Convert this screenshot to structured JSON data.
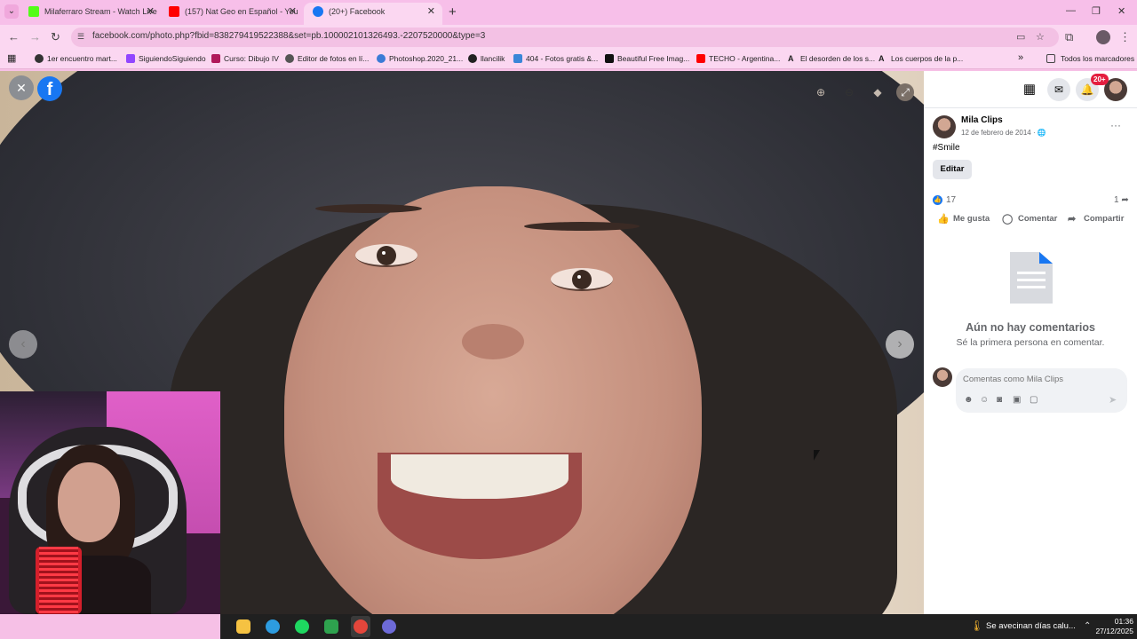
{
  "browser": {
    "tabs": [
      {
        "title": "Milaferraro Stream - Watch Live",
        "favicon_color": "#53fc18"
      },
      {
        "title": "(157) Nat Geo en Español - You",
        "favicon_color": "#ff0000"
      },
      {
        "title": "(20+) Facebook",
        "favicon_color": "#1877f2"
      }
    ],
    "new_tab": "+",
    "window_controls": {
      "minimize": "—",
      "restore": "❐",
      "close": "✕"
    },
    "url": "facebook.com/photo.php?fbid=838279419522388&set=pb.100002101326493.-2207520000&type=3",
    "bookmarks": [
      {
        "label": "1er encuentro mart...",
        "color": "#333333"
      },
      {
        "label": "SiguiendoSiguiendo",
        "color": "#9146ff"
      },
      {
        "label": "Curso: Dibujo IV",
        "color": "#b0185a"
      },
      {
        "label": "Editor de fotos en lí...",
        "color": "#555555"
      },
      {
        "label": "Photoshop.2020_21...",
        "color": "#3b7bd6"
      },
      {
        "label": "llancilik",
        "color": "#222222"
      },
      {
        "label": "404 - Fotos gratis &...",
        "color": "#3a86d8"
      },
      {
        "label": "Beautiful Free Imag...",
        "color": "#111111"
      },
      {
        "label": "TECHO - Argentina...",
        "color": "#ff0000"
      },
      {
        "label": "El desorden de los s...",
        "color": "#111111"
      },
      {
        "label": "Los cuerpos de la p...",
        "color": "#111111"
      }
    ],
    "bookmarks_more": "»",
    "all_bookmarks": "Todos los marcadores"
  },
  "facebook": {
    "logo_letter": "f",
    "notifications_badge": "20+",
    "post": {
      "author": "Mila Clips",
      "date": "12 de febrero de 2014 · 🌐",
      "caption": "#Smile",
      "edit_label": "Editar",
      "likes": "17",
      "shares": "1",
      "actions": {
        "like": "Me gusta",
        "comment": "Comentar",
        "share": "Compartir"
      }
    },
    "comments": {
      "empty_title": "Aún no hay comentarios",
      "empty_subtitle": "Sé la primera persona en comentar.",
      "input_placeholder": "Comentas como Mila Clips"
    }
  },
  "taskbar": {
    "weather_text": "Se avecinan días calu...",
    "time": "01:36",
    "date": "27/12/2025"
  }
}
